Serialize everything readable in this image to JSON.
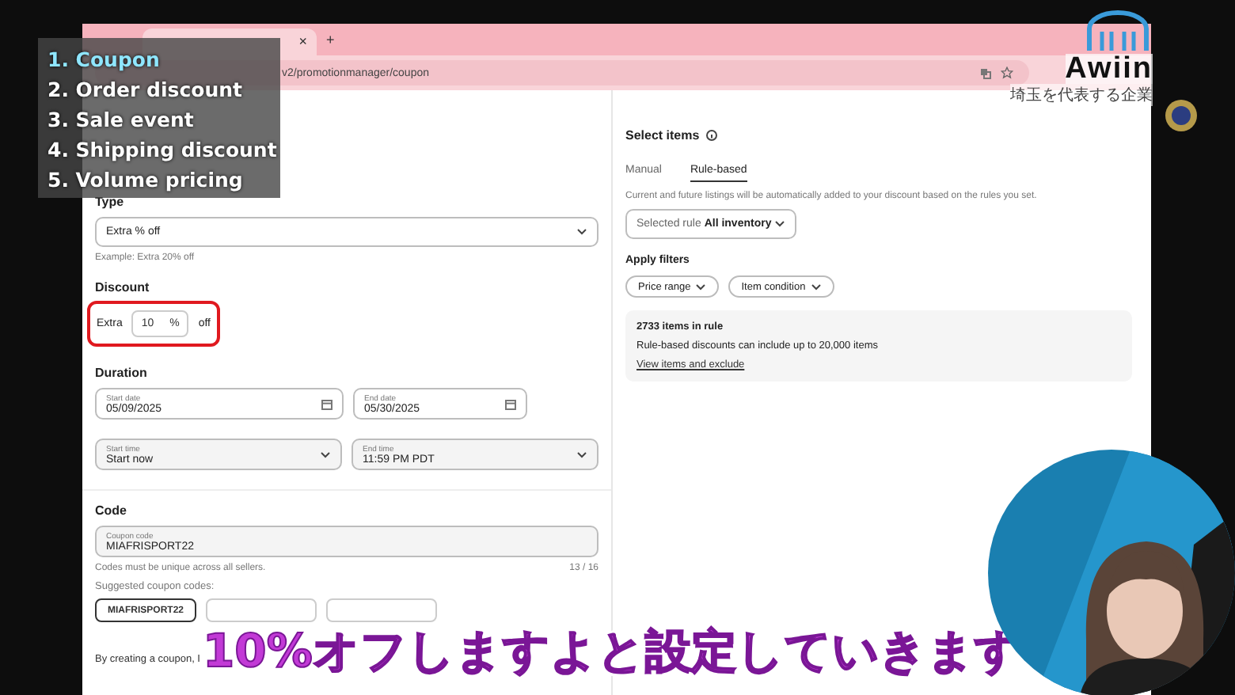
{
  "topics": [
    {
      "label": "1. Coupon",
      "selected": true
    },
    {
      "label": "2. Order discount",
      "selected": false
    },
    {
      "label": "3. Sale event",
      "selected": false
    },
    {
      "label": "4. Shipping discount",
      "selected": false
    },
    {
      "label": "5. Volume pricing",
      "selected": false
    }
  ],
  "browser": {
    "close": "×",
    "new_tab": "+",
    "url": "v2/promotionmanager/coupon"
  },
  "left": {
    "type_label": "Type",
    "type_value": "Extra % off",
    "type_hint": "Example: Extra 20% off",
    "discount_label": "Discount",
    "discount_prefix": "Extra",
    "discount_value": "10",
    "discount_unit": "%",
    "discount_suffix": "off",
    "highlighted": true,
    "duration_label": "Duration",
    "dates": [
      {
        "label": "Start date",
        "value": "05/09/2025"
      },
      {
        "label": "End date",
        "value": "05/30/2025"
      }
    ],
    "times": [
      {
        "label": "Start time",
        "value": "Start now"
      },
      {
        "label": "End time",
        "value": "11:59 PM PDT"
      }
    ],
    "code_label": "Code",
    "code_field_label": "Coupon code",
    "code_value": "MIAFRISPORT22",
    "code_hint": "Codes must be unique across all sellers.",
    "code_count": "13 / 16",
    "suggested_label": "Suggested coupon codes:",
    "suggested": [
      {
        "label": "MIAFRISPORT22",
        "selected": true
      },
      {
        "selected": false
      },
      {
        "selected": false
      }
    ],
    "terms": "By creating a coupon, I"
  },
  "right": {
    "title": "Select items",
    "tabs": [
      {
        "label": "Manual",
        "selected": false
      },
      {
        "label": "Rule-based",
        "selected": true
      }
    ],
    "description": "Current and future listings will be automatically added to your discount based on the rules you set.",
    "rule_prefix": "Selected rule",
    "rule_value": "All inventory",
    "filters_label": "Apply filters",
    "filters": [
      "Price range",
      "Item condition"
    ],
    "summary": {
      "count": "2733 items in rule",
      "note": "Rule-based discounts can include up to 20,000 items",
      "link": "View items and exclude"
    }
  },
  "logo": {
    "name": "Awiin",
    "tagline": "埼玉を代表する企業"
  },
  "subtitle": "10%オフしますよと設定していきます"
}
